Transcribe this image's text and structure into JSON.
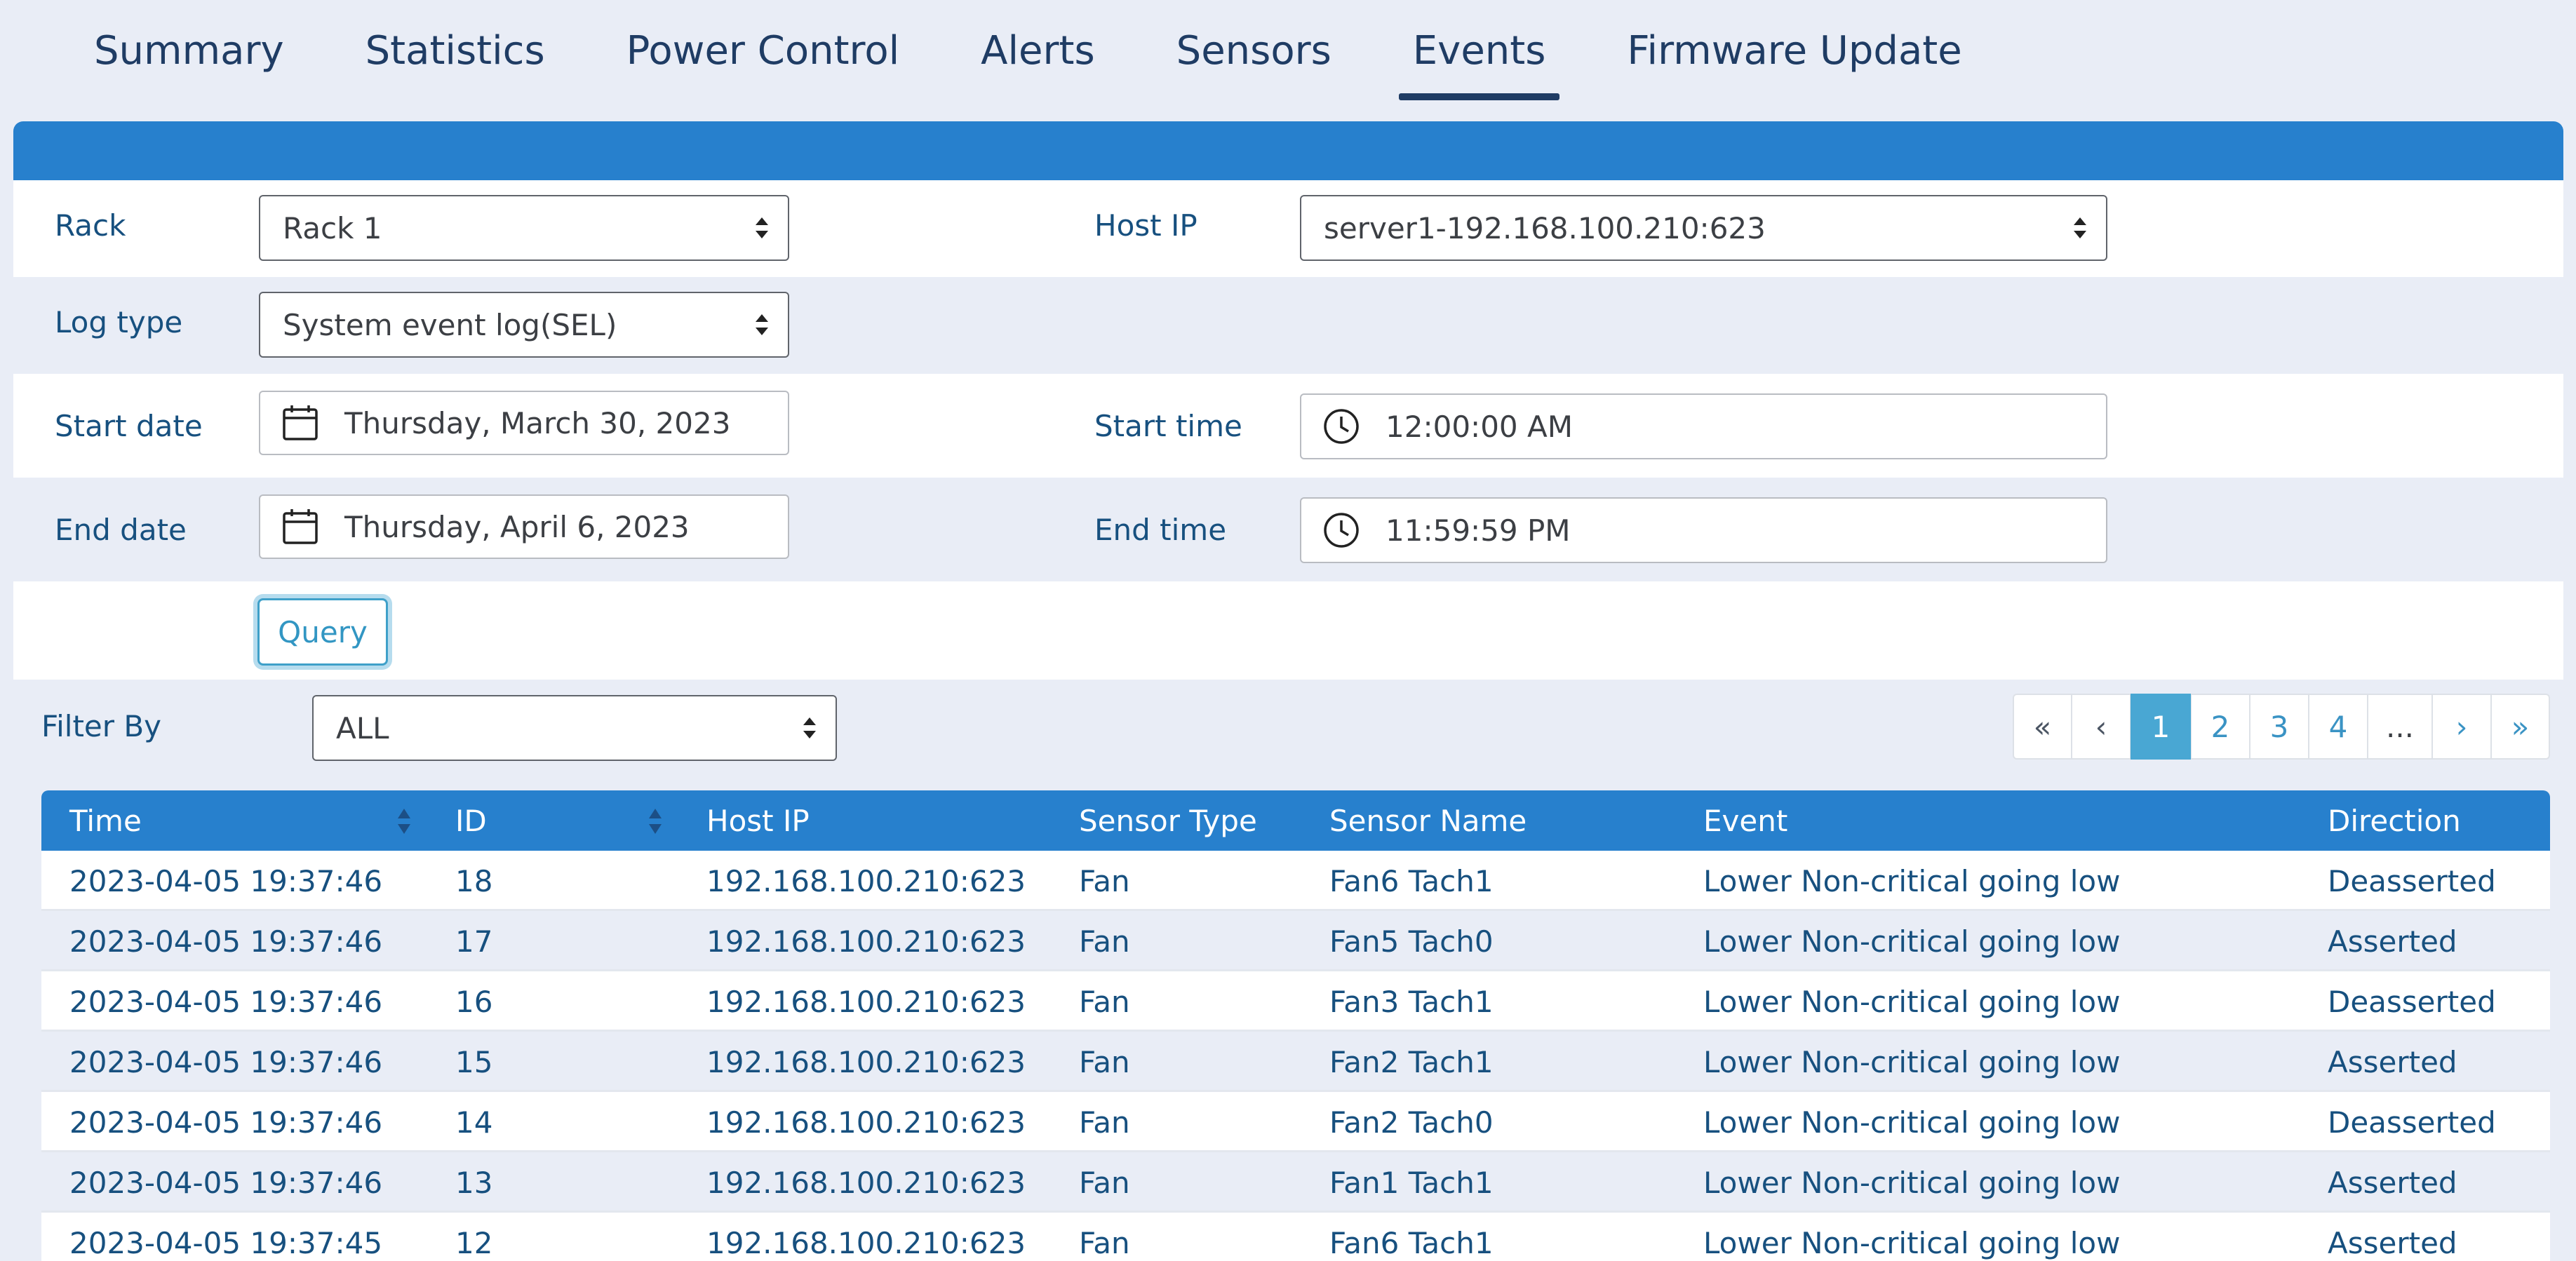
{
  "tabs": [
    "Summary",
    "Statistics",
    "Power Control",
    "Alerts",
    "Sensors",
    "Events",
    "Firmware Update"
  ],
  "active_tab": "Events",
  "form": {
    "rack_label": "Rack",
    "rack_value": "Rack 1",
    "host_ip_label": "Host IP",
    "host_ip_value": "server1-192.168.100.210:623",
    "log_type_label": "Log type",
    "log_type_value": "System event log(SEL)",
    "start_date_label": "Start date",
    "start_date_value": "Thursday, March 30, 2023",
    "start_time_label": "Start time",
    "start_time_value": "12:00:00 AM",
    "end_date_label": "End date",
    "end_date_value": "Thursday, April 6, 2023",
    "end_time_label": "End time",
    "end_time_value": "11:59:59 PM",
    "query_label": "Query"
  },
  "filter": {
    "label": "Filter By",
    "value": "ALL"
  },
  "pagination": {
    "first": "«",
    "prev": "‹",
    "pages": [
      "1",
      "2",
      "3",
      "4"
    ],
    "ellipsis": "...",
    "next": "›",
    "last": "»",
    "current": "1"
  },
  "table": {
    "columns": [
      "Time",
      "ID",
      "Host IP",
      "Sensor Type",
      "Sensor Name",
      "Event",
      "Direction"
    ],
    "rows": [
      [
        "2023-04-05 19:37:46",
        "18",
        "192.168.100.210:623",
        "Fan",
        "Fan6 Tach1",
        "Lower Non-critical going low",
        "Deasserted"
      ],
      [
        "2023-04-05 19:37:46",
        "17",
        "192.168.100.210:623",
        "Fan",
        "Fan5 Tach0",
        "Lower Non-critical going low",
        "Asserted"
      ],
      [
        "2023-04-05 19:37:46",
        "16",
        "192.168.100.210:623",
        "Fan",
        "Fan3 Tach1",
        "Lower Non-critical going low",
        "Deasserted"
      ],
      [
        "2023-04-05 19:37:46",
        "15",
        "192.168.100.210:623",
        "Fan",
        "Fan2 Tach1",
        "Lower Non-critical going low",
        "Asserted"
      ],
      [
        "2023-04-05 19:37:46",
        "14",
        "192.168.100.210:623",
        "Fan",
        "Fan2 Tach0",
        "Lower Non-critical going low",
        "Deasserted"
      ],
      [
        "2023-04-05 19:37:46",
        "13",
        "192.168.100.210:623",
        "Fan",
        "Fan1 Tach1",
        "Lower Non-critical going low",
        "Asserted"
      ],
      [
        "2023-04-05 19:37:45",
        "12",
        "192.168.100.210:623",
        "Fan",
        "Fan6 Tach1",
        "Lower Non-critical going low",
        "Asserted"
      ]
    ]
  },
  "icons": {
    "calendar": "calendar-icon",
    "clock": "clock-icon"
  },
  "colors": {
    "accent": "#2780cd",
    "active_tab": "#1f3c64",
    "text": "#17507f",
    "page_active": "#49a7d3"
  }
}
